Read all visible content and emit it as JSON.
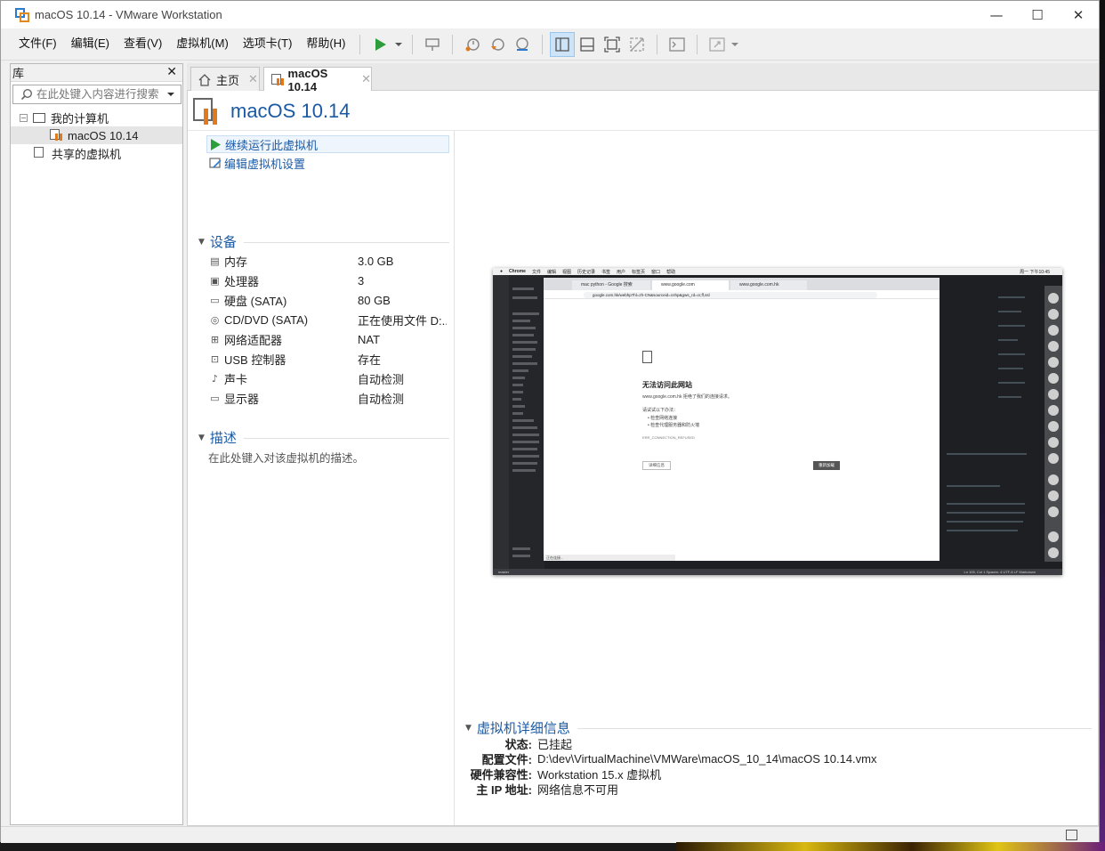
{
  "window": {
    "title": "macOS 10.14 - VMware Workstation",
    "controls": {
      "minimize": "—",
      "maximize": "☐",
      "close": "✕"
    }
  },
  "menu": [
    "文件(F)",
    "编辑(E)",
    "查看(V)",
    "虚拟机(M)",
    "选项卡(T)",
    "帮助(H)"
  ],
  "toolbar_icons": [
    "play-icon",
    "dropdown-arrow-icon",
    "send-ctrl-alt-del-icon",
    "snapshot-icon",
    "revert-snapshot-icon",
    "snapshot-manager-icon",
    "show-library-icon",
    "show-thumbnail-bar-icon",
    "fullscreen-icon",
    "unity-icon",
    "console-icon",
    "stretch-icon"
  ],
  "library": {
    "title": "库",
    "close": "✕",
    "search_placeholder": "在此处键入内容进行搜索",
    "tree": [
      {
        "label": "我的计算机",
        "expander": "−"
      },
      {
        "label": "macOS 10.14"
      },
      {
        "label": "共享的虚拟机"
      }
    ]
  },
  "tabs": [
    {
      "label": "主页",
      "close": "✕"
    },
    {
      "label": "macOS 10.14",
      "close": "✕"
    }
  ],
  "vm": {
    "name": "macOS 10.14",
    "actions": {
      "resume": "继续运行此虚拟机",
      "edit": "编辑虚拟机设置"
    },
    "devices_title": "设备",
    "devices": [
      {
        "icon": "memory-icon",
        "name": "内存",
        "value": "3.0 GB"
      },
      {
        "icon": "cpu-icon",
        "name": "处理器",
        "value": "3"
      },
      {
        "icon": "hard-disk-icon",
        "name": "硬盘 (SATA)",
        "value": "80 GB"
      },
      {
        "icon": "cd-dvd-icon",
        "name": "CD/DVD (SATA)",
        "value": "正在使用文件 D:..."
      },
      {
        "icon": "network-adapter-icon",
        "name": "网络适配器",
        "value": "NAT"
      },
      {
        "icon": "usb-icon",
        "name": "USB 控制器",
        "value": "存在"
      },
      {
        "icon": "sound-icon",
        "name": "声卡",
        "value": "自动检测"
      },
      {
        "icon": "display-icon",
        "name": "显示器",
        "value": "自动检测"
      }
    ],
    "description_title": "描述",
    "description_placeholder": "在此处键入对该虚拟机的描述。",
    "details_title": "虚拟机详细信息",
    "details": [
      {
        "key": "状态:",
        "value": "已挂起"
      },
      {
        "key": "配置文件:",
        "value": "D:\\dev\\VirtualMachine\\VMWare\\macOS_10_14\\macOS 10.14.vmx"
      },
      {
        "key": "硬件兼容性:",
        "value": "Workstation 15.x 虚拟机"
      },
      {
        "key": "主 IP 地址:",
        "value": "网络信息不可用"
      }
    ]
  },
  "preview": {
    "mac_menu": [
      "Chrome",
      "文件",
      "编辑",
      "视图",
      "历史记录",
      "书签",
      "用户",
      "标签页",
      "窗口",
      "帮助"
    ],
    "mac_clock": "周一 下午10:45",
    "chrome_tabs": [
      "mac python - Google 搜索",
      "www.google.com",
      "www.google.com.hk"
    ],
    "url": "google.com.hk/webhp?hl=zh-CN&sourceid=cnhp&gws_rd=cr,ff,ssl",
    "error_title": "无法访问此网站",
    "error_host": "www.google.com.hk 拒绝了我们的连接请求。",
    "error_try": "请试试以下办法：",
    "error_tips": [
      "• 检查网络连接",
      "• 检查代理服务器和防火墙"
    ],
    "error_code": "ERR_CONNECTION_REFUSED",
    "details_btn": "详细信息",
    "reload_btn": "重新加载",
    "chrome_status": "正在连接...",
    "vscode_status": "master",
    "vscode_status_right": "Ln 105, Col 1   Spaces: 4   UTF-8   LF   Markdown"
  }
}
